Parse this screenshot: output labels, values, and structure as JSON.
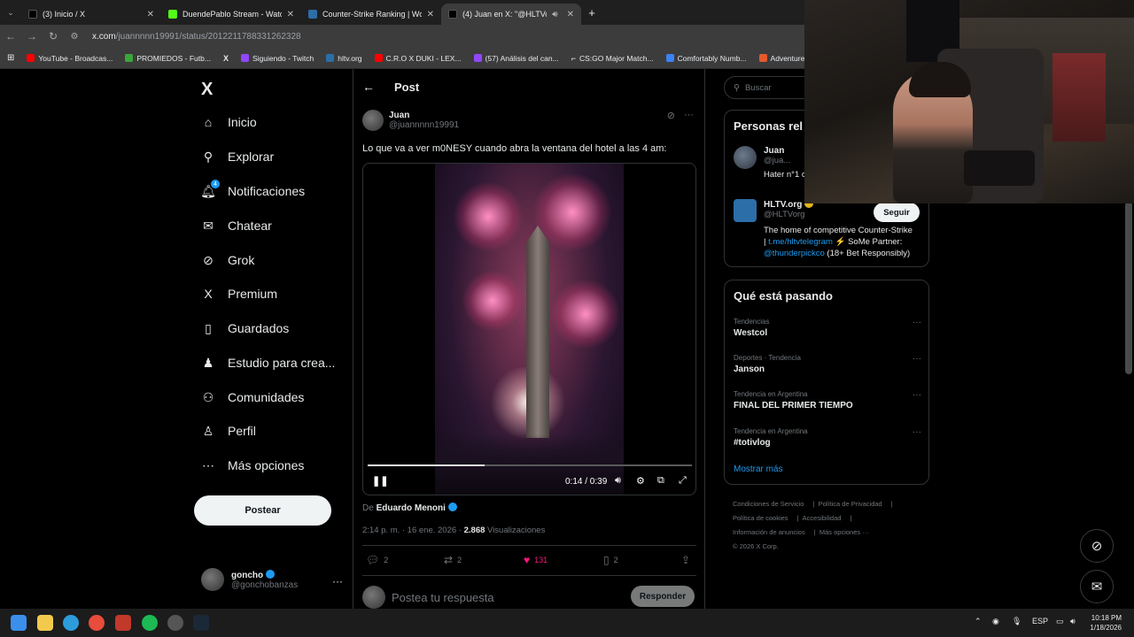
{
  "browser": {
    "tabs": [
      {
        "label": "(3) Inicio / X",
        "favicon": "x-logo",
        "active": false
      },
      {
        "label": "DuendePablo Stream - Watch L",
        "favicon": "kick-logo",
        "active": false
      },
      {
        "label": "Counter-Strike Ranking | World",
        "favicon": "hltv-logo",
        "active": false
      },
      {
        "label": "(4) Juan en X: \"@HLTVorg L",
        "favicon": "x-logo",
        "active": true
      }
    ],
    "new_tab": "+",
    "url_host": "x.com",
    "url_path": "/juannnnn19991/status/2012211788331262328",
    "bookmarks": [
      {
        "label": "YouTube - Broadcas...",
        "color": "#ff0000"
      },
      {
        "label": "PROMIEDOS - Futb...",
        "color": "#3aa63a"
      },
      {
        "label": "",
        "color": "#000000"
      },
      {
        "label": "Siguiendo - Twitch",
        "color": "#9146ff"
      },
      {
        "label": "hltv.org",
        "color": "#2c6ea8"
      },
      {
        "label": "C.R.O X DUKI - LEX...",
        "color": "#ff0000"
      },
      {
        "label": "(57) Análisis del can...",
        "color": "#9146ff"
      },
      {
        "label": "CS:GO Major Match...",
        "color": "#cccccc"
      },
      {
        "label": "Comfortably Numb...",
        "color": "#3b82f6"
      },
      {
        "label": "Adventure and RPG...",
        "color": "#e45a2c"
      }
    ]
  },
  "nav": {
    "items": [
      {
        "label": "Inicio",
        "icon": "home-icon",
        "glyph": "⌂"
      },
      {
        "label": "Explorar",
        "icon": "search-icon",
        "glyph": "⚲"
      },
      {
        "label": "Notificaciones",
        "icon": "bell-icon",
        "glyph": "🔔︎"
      },
      {
        "label": "Chatear",
        "icon": "mail-icon",
        "glyph": "✉"
      },
      {
        "label": "Grok",
        "icon": "grok-icon",
        "glyph": "⊘"
      },
      {
        "label": "Premium",
        "icon": "x-icon",
        "glyph": "X"
      },
      {
        "label": "Guardados",
        "icon": "bookmark-icon",
        "glyph": "▯"
      },
      {
        "label": "Estudio para crea...",
        "icon": "studio-icon",
        "glyph": "♟"
      },
      {
        "label": "Comunidades",
        "icon": "communities-icon",
        "glyph": "⚇"
      },
      {
        "label": "Perfil",
        "icon": "profile-icon",
        "glyph": "♙"
      },
      {
        "label": "Más opciones",
        "icon": "more-circle-icon",
        "glyph": "⋯"
      }
    ],
    "notif_badge": "4",
    "post_button": "Postear",
    "account": {
      "name": "goncho",
      "handle": "@gonchobanzas"
    }
  },
  "post": {
    "header_title": "Post",
    "author_name": "Juan",
    "author_handle": "@juannnnn19991",
    "text": "Lo que va a ver m0NESY cuando abra la ventana del hotel a las 4 am:",
    "video": {
      "time": "0:14 / 0:39",
      "progress": 0.36
    },
    "from_prefix": "De",
    "from_name": "Eduardo Menoni",
    "timestamp": "2:14 p. m. · 16 ene. 2026 ·",
    "views_count": "2.868",
    "views_label": "Visualizaciones",
    "replies": "2",
    "reposts": "2",
    "likes": "131",
    "bookmarks": "2",
    "reply_placeholder": "Postea tu respuesta",
    "reply_button": "Responder"
  },
  "right": {
    "search_placeholder": "Buscar",
    "people_title": "Personas rel",
    "people": [
      {
        "name": "Juan",
        "handle": "@jua...",
        "bio": "Hater n°1 c"
      },
      {
        "name": "HLTV.org",
        "handle": "@HLTVorg",
        "follow": "Seguir",
        "bio_1": "The home of competitive Counter-Strike",
        "bio_2a": "| ",
        "bio_2_link": "t.me/hltvtelegram",
        "bio_2b": " ⚡ SoMe Partner:",
        "bio_3_link": "@thunderpickco",
        "bio_3b": " (18+ Bet Responsibly)"
      }
    ],
    "trends_title": "Qué está pasando",
    "trends": [
      {
        "context": "Tendencias",
        "name": "Westcol"
      },
      {
        "context": "Deportes · Tendencia",
        "name": "Janson"
      },
      {
        "context": "Tendencia en Argentina",
        "name": "FINAL DEL PRIMER TIEMPO"
      },
      {
        "context": "Tendencia en Argentina",
        "name": "#totivlog"
      }
    ],
    "show_more": "Mostrar más",
    "footer": {
      "l1a": "Condiciones de Servicio",
      "l1b": "Política de Privacidad",
      "l2a": "Política de cookies",
      "l2b": "Accesibilidad",
      "l3a": "Información de anuncios",
      "l3b": "Más opciones ···",
      "copyright": "© 2026 X Corp."
    }
  },
  "taskbar": {
    "lang": "ESP",
    "time": "10:18 PM",
    "date": "1/18/2026"
  }
}
